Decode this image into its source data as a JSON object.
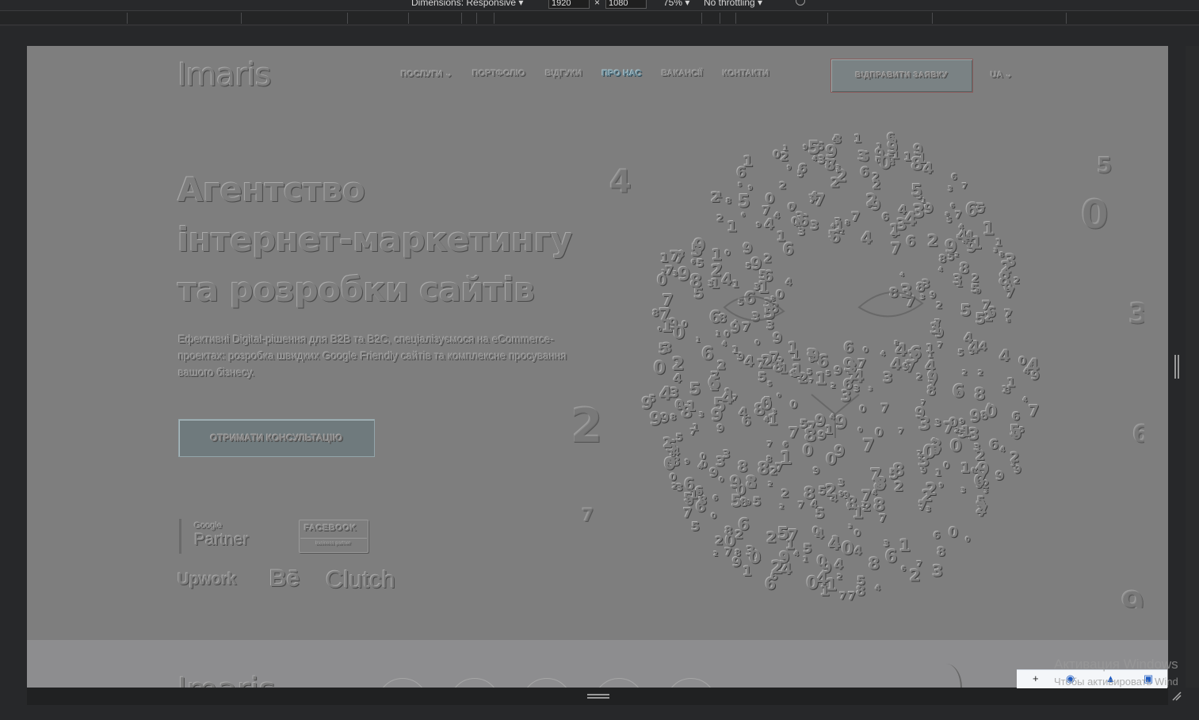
{
  "devtools": {
    "dimensions_label": "Dimensions: Responsive ▾",
    "width_value": "1920",
    "height_value": "1080",
    "times": "×",
    "zoom": "75% ▾",
    "throttling": "No throttling ▾"
  },
  "site": {
    "logo": "Imaris",
    "nav": [
      {
        "label": "ПОСЛУГИ ⌄"
      },
      {
        "label": "ПОРТФОЛІО"
      },
      {
        "label": "ВІДГУКИ"
      },
      {
        "label": "ПРО НАС"
      },
      {
        "label": "ВАКАНСІЇ"
      },
      {
        "label": "КОНТАКТИ"
      }
    ],
    "cta_top": "ВІДПРАВИТИ ЗАЯВКУ",
    "lang": "UA ⌄",
    "hero_title_lines": [
      "Агентство",
      "інтернет-маркетингу",
      "та розробки сайтів"
    ],
    "hero_subtitle": "Ефективні Digital-рішення для B2B та B2C, спеціалізуємося на eCommerce-проектах: розробка швидких Google Friendly сайтів та комплексне просування вашого бізнесу.",
    "cta_consult": "ОТРИМАТИ КОНСУЛЬТАЦІЮ",
    "badges": {
      "google_small": "Google",
      "google_big": "Partner",
      "facebook_title": "FACEBOOK",
      "facebook_sub": "business partner"
    },
    "partner_logos": [
      "Upwork",
      "Bē",
      "Clutch"
    ],
    "lower_logo": "Imaris"
  },
  "system": {
    "activate_title": "Активация Windows",
    "activate_sub": "Чтобы активировать Wind"
  }
}
